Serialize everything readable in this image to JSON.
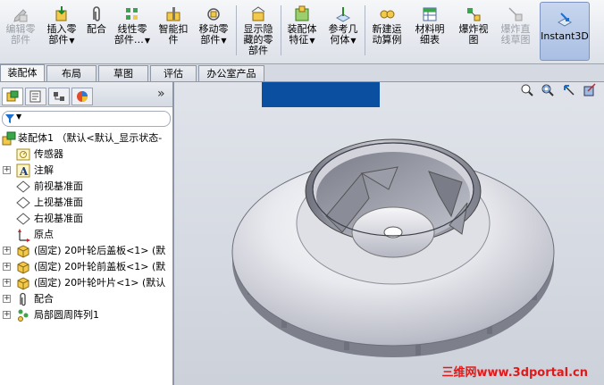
{
  "ribbon": {
    "buttons": [
      {
        "label": "编辑零\n部件",
        "disabled": true
      },
      {
        "label": "插入零\n部件",
        "dropdown": true
      },
      {
        "label": "配合"
      },
      {
        "label": "线性零\n部件…",
        "dropdown": true
      },
      {
        "label": "智能扣\n件"
      },
      {
        "label": "移动零\n部件",
        "dropdown": true
      },
      {
        "label": "显示隐\n藏的零\n部件"
      },
      {
        "label": "装配体\n特征",
        "dropdown": true
      },
      {
        "label": "参考几\n何体",
        "dropdown": true
      },
      {
        "label": "新建运\n动算例"
      },
      {
        "label": "材料明\n细表"
      },
      {
        "label": "爆炸视\n图"
      },
      {
        "label": "爆炸直\n线草图",
        "disabled": true
      }
    ],
    "instant3d_label": "Instant3D"
  },
  "tabs": [
    "装配体",
    "布局",
    "草图",
    "评估",
    "办公室产品"
  ],
  "tree": {
    "root": "装配体1  （默认<默认_显示状态-",
    "items": [
      {
        "label": "传感器",
        "icon": "sensor-icon",
        "expandable": false
      },
      {
        "label": "注解",
        "icon": "annotation-icon",
        "expandable": true
      },
      {
        "label": "前视基准面",
        "icon": "plane-icon",
        "expandable": false
      },
      {
        "label": "上视基准面",
        "icon": "plane-icon",
        "expandable": false
      },
      {
        "label": "右视基准面",
        "icon": "plane-icon",
        "expandable": false
      },
      {
        "label": "原点",
        "icon": "origin-icon",
        "expandable": false
      },
      {
        "label": "(固定) 20叶轮后盖板<1> (默",
        "icon": "part-icon",
        "expandable": true
      },
      {
        "label": "(固定) 20叶轮前盖板<1> (默",
        "icon": "part-icon",
        "expandable": true
      },
      {
        "label": "(固定) 20叶轮叶片<1> (默认",
        "icon": "part-icon",
        "expandable": true
      },
      {
        "label": "配合",
        "icon": "mates-icon",
        "expandable": true
      },
      {
        "label": "局部圆周阵列1",
        "icon": "pattern-icon",
        "expandable": true
      }
    ]
  },
  "watermark": "三维网www.3dportal.cn",
  "colors": {
    "accent_blue": "#0b4fa0",
    "watermark_red": "#e01a1a"
  }
}
